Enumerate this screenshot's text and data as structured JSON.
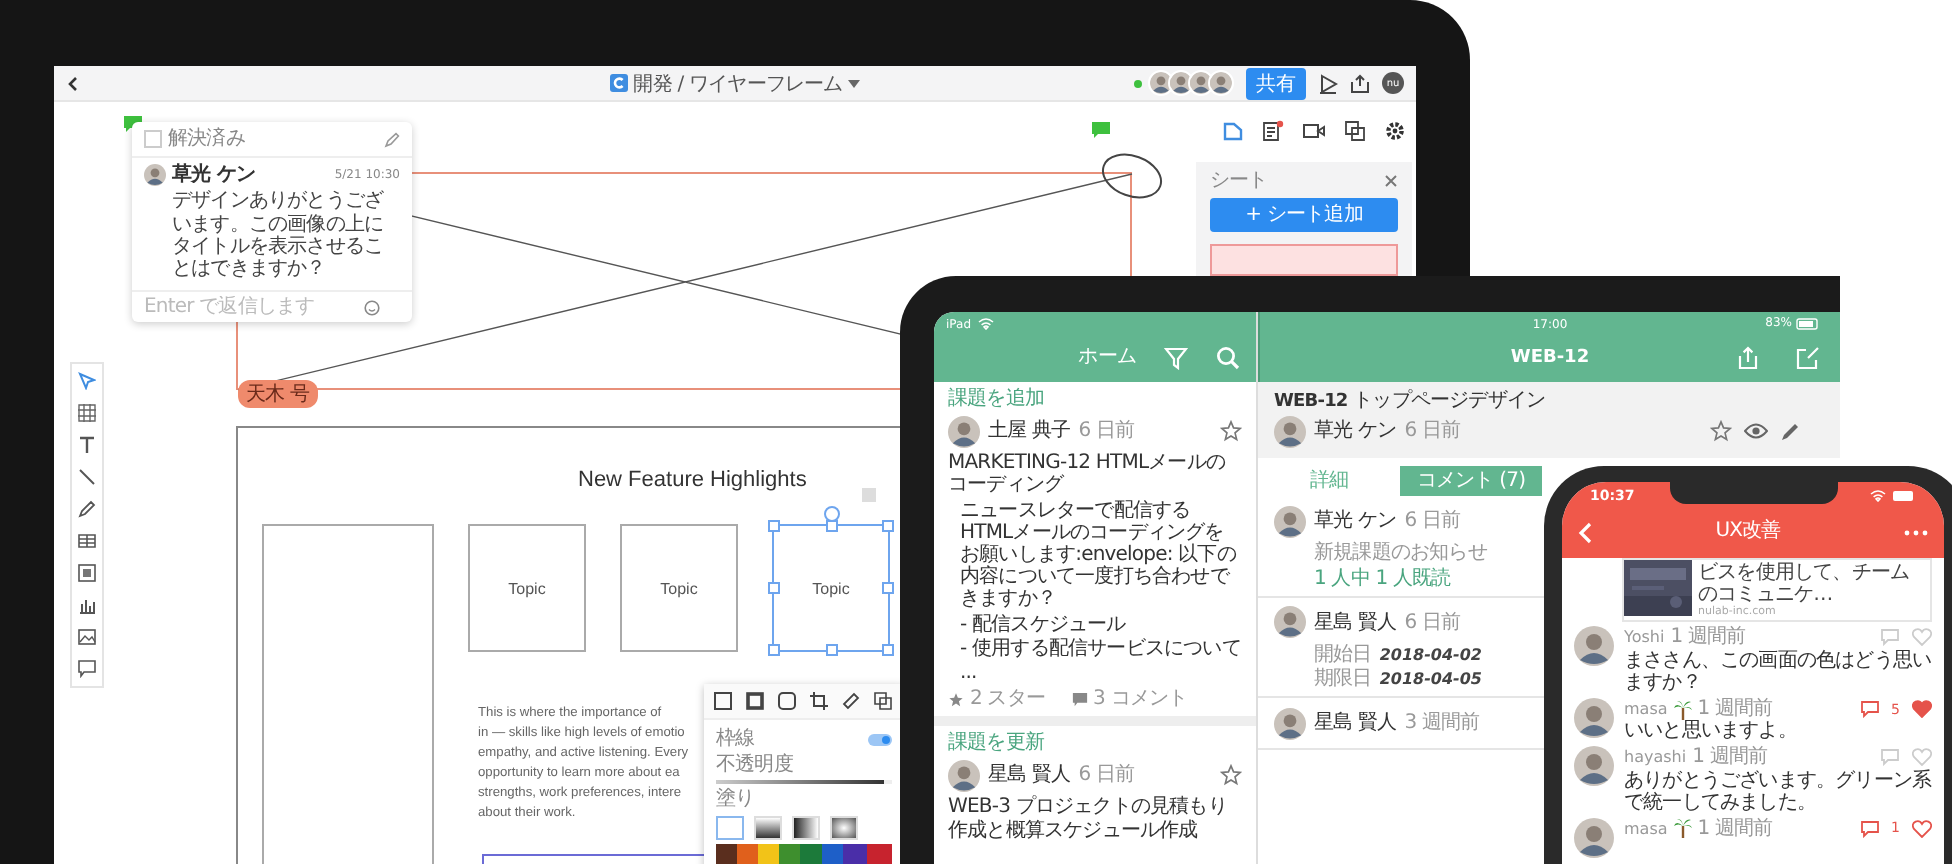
{
  "laptop": {
    "breadcrumb": "開発 / ワイヤーフレーム",
    "share_button": "共有",
    "user_initials": "nu",
    "comment": {
      "resolved_label": "解決済み",
      "resolved": false,
      "author": "草光 ケン",
      "time": "5/21 10:30",
      "text": "デザインありがとうございます。この画像の上にタイトルを表示させることはできますか？",
      "reply_placeholder": "Enter で返信します"
    },
    "frame_label": "天木 号",
    "sheet_panel": {
      "title": "シート",
      "add_button": "+ シート追加"
    },
    "slide": {
      "title": "New Feature Highlights",
      "topics": [
        {
          "label": "Topic",
          "selected": false
        },
        {
          "label": "Topic",
          "selected": false
        },
        {
          "label": "Topic",
          "selected": true
        }
      ],
      "paragraph_lines": [
        "This is where the importance of",
        "in — skills like high levels of emotio",
        "empathy, and active listening. Every",
        "opportunity to learn more about ea",
        "strengths, work preferences, intere",
        "about their work."
      ]
    },
    "style_popup": {
      "border_label": "枠線",
      "border_on": true,
      "opacity_label": "不透明度",
      "opacity": {
        "level": 0.95
      },
      "fill_label": "塗り"
    }
  },
  "tablet": {
    "left": {
      "status": "iPad",
      "title": "ホーム",
      "posts": [
        {
          "label": "課題を追加",
          "author": "土屋 典子",
          "time": "6 日前",
          "starred": false,
          "title": "MARKETING-12 HTMLメールのコーディング",
          "quote": "ニュースレターで配信するHTMLメールのコーディングをお願いします:envelope: 以下の内容について一度打ち合わせできますか？",
          "list": [
            "- 配信スケジュール",
            "- 使用する配信サービスについて",
            "..."
          ],
          "stars": "2 スター",
          "comments": "3 コメント"
        },
        {
          "label": "課題を更新",
          "author": "星島 賢人",
          "time": "6 日前",
          "starred": false,
          "title": "WEB-3 プロジェクトの見積もり作成と概算スケジュール作成"
        }
      ]
    },
    "right": {
      "time": "17:00",
      "battery": "83%",
      "title": "WEB-12",
      "issue_key": "WEB-12",
      "issue_title": "トップページデザイン",
      "author": "草光 ケン",
      "author_time": "6 日前",
      "tabs": [
        {
          "label": "詳細",
          "selected": false
        },
        {
          "label": "コメント (7)",
          "selected": true
        }
      ],
      "comments": [
        {
          "author": "草光 ケン",
          "time": "6 日前",
          "text": "新規課題のお知らせ",
          "read": "1 人中 1 人既読"
        },
        {
          "author": "星島 賢人",
          "time": "6 日前",
          "fields": [
            {
              "label": "開始日",
              "value": "2018-04-02"
            },
            {
              "label": "期限日",
              "value": "2018-04-05"
            }
          ]
        },
        {
          "author": "星島 賢人",
          "time": "3 週間前"
        }
      ]
    }
  },
  "phone": {
    "time": "10:37",
    "title": "UX改善",
    "link": {
      "text": "ビスを使用して、チームのコミュニケ…",
      "domain": "nulab-inc.com"
    },
    "comments": [
      {
        "author": "Yoshi",
        "status_badge": false,
        "time": "1 週間前",
        "text": "まささん、この画面の色はどう思いますか？",
        "replied": false,
        "liked": false
      },
      {
        "author": "masa",
        "status_badge": true,
        "time": "1 週間前",
        "text": "いいと思いますよ。",
        "replied": true,
        "like_count": "5",
        "liked": true
      },
      {
        "author": "hayashi",
        "status_badge": false,
        "time": "1 週間前",
        "text": "ありがとうございます。グリーン系で統一してみました。",
        "replied": false,
        "liked": false
      },
      {
        "author": "masa",
        "status_badge": true,
        "time": "1 週間前",
        "replied": true,
        "like_count": "1",
        "liked": false
      }
    ]
  }
}
